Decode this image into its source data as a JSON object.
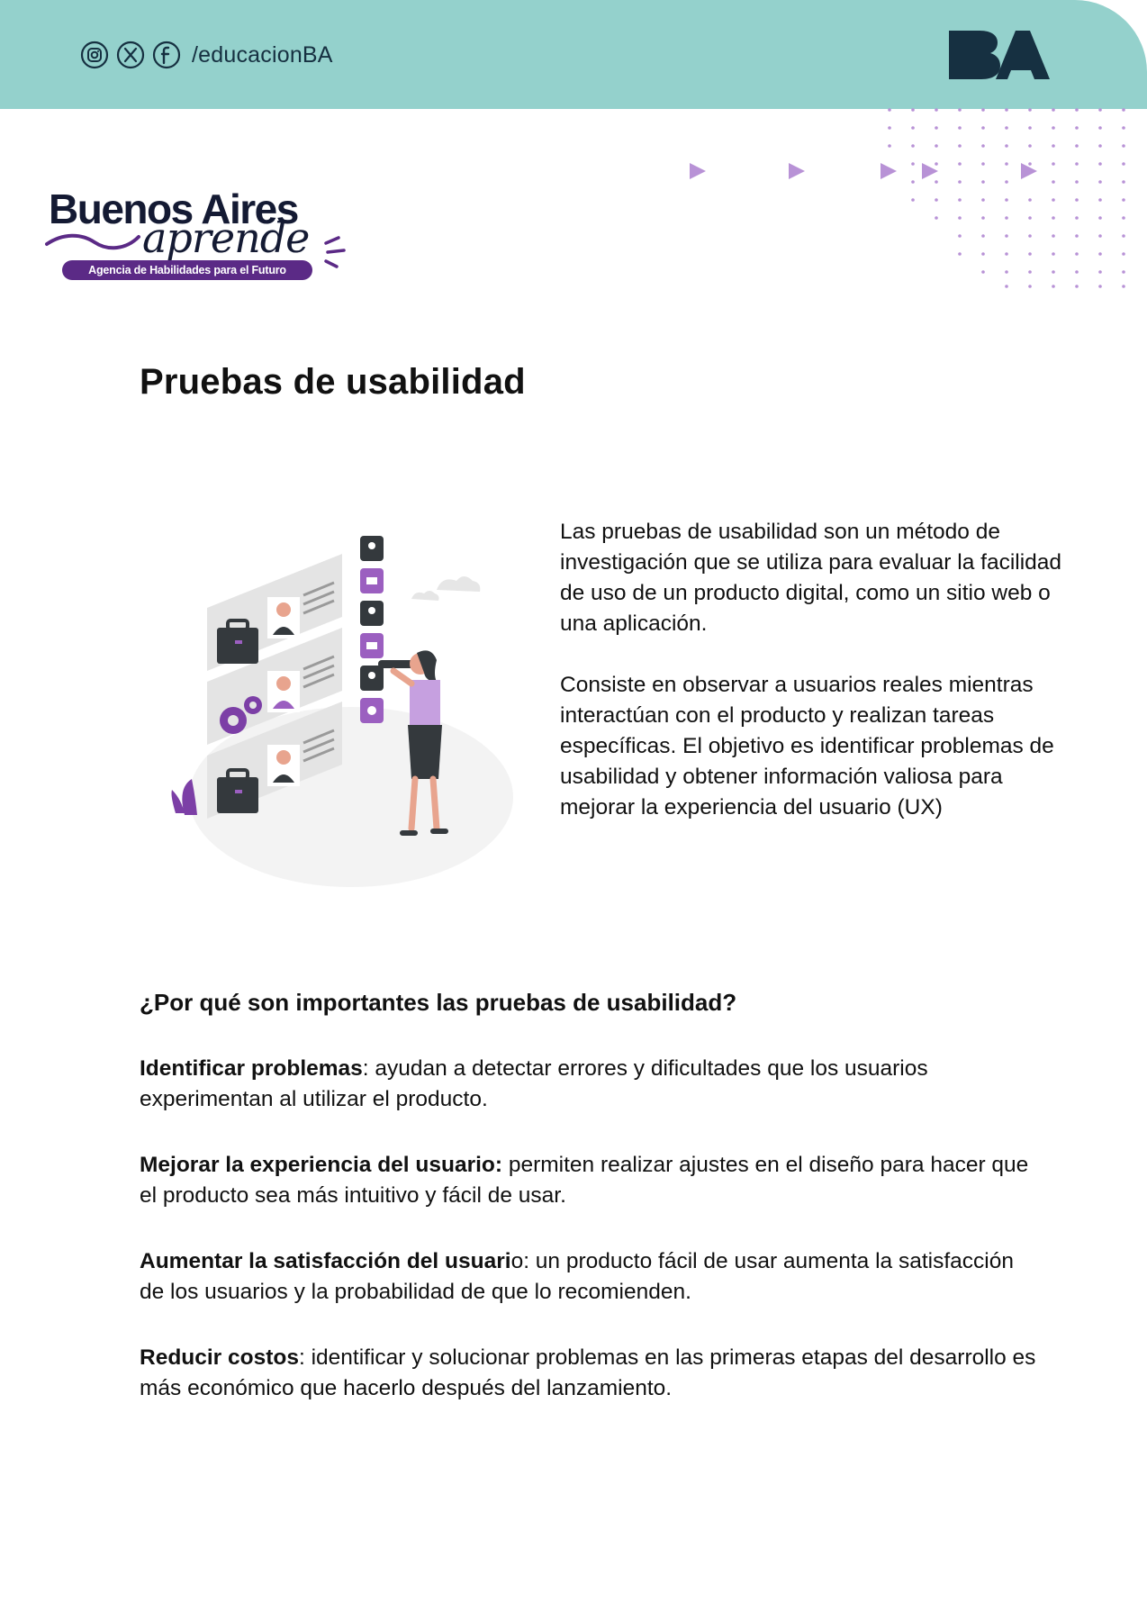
{
  "header": {
    "social_handle": "/educacionBA",
    "social_icons": [
      "instagram-icon",
      "x-icon",
      "facebook-icon"
    ],
    "logo_text": "BA",
    "band_color": "#94d1cc"
  },
  "brand": {
    "line1": "Buenos Aires",
    "line2": "aprende",
    "tagline": "Agencia de Habilidades para el Futuro",
    "accent_color": "#5b2a86"
  },
  "title": "Pruebas de usabilidad",
  "intro": {
    "p1": "Las pruebas de usabilidad son un método de investigación que se utiliza para evaluar la facilidad de uso de un producto digital, como un sitio web o una aplicación.",
    "p2": "Consiste en observar a usuarios reales mientras interactúan con el producto y realizan tareas específicas. El objetivo es identificar problemas de usabilidad y obtener información valiosa para mejorar la experiencia del usuario (UX)"
  },
  "section": {
    "heading": "¿Por qué son importantes las pruebas de usabilidad?",
    "items": [
      {
        "bold": "Identificar problemas",
        "rest": ": ayudan a detectar errores y dificultades que los usuarios experimentan al utilizar el producto."
      },
      {
        "bold": "Mejorar la experiencia del usuario:",
        "rest": " permiten realizar ajustes en el diseño para hacer que el producto sea más intuitivo y fácil de usar."
      },
      {
        "bold": "Aumentar la satisfacción del usuari",
        "rest": "o: un producto fácil de usar aumenta la satisfacción de los usuarios y la probabilidad de que lo recomienden."
      },
      {
        "bold": "Reducir costos",
        "rest": ": identificar y solucionar problemas en las primeras etapas del desarrollo es más económico que hacerlo después del lanzamiento."
      }
    ]
  }
}
